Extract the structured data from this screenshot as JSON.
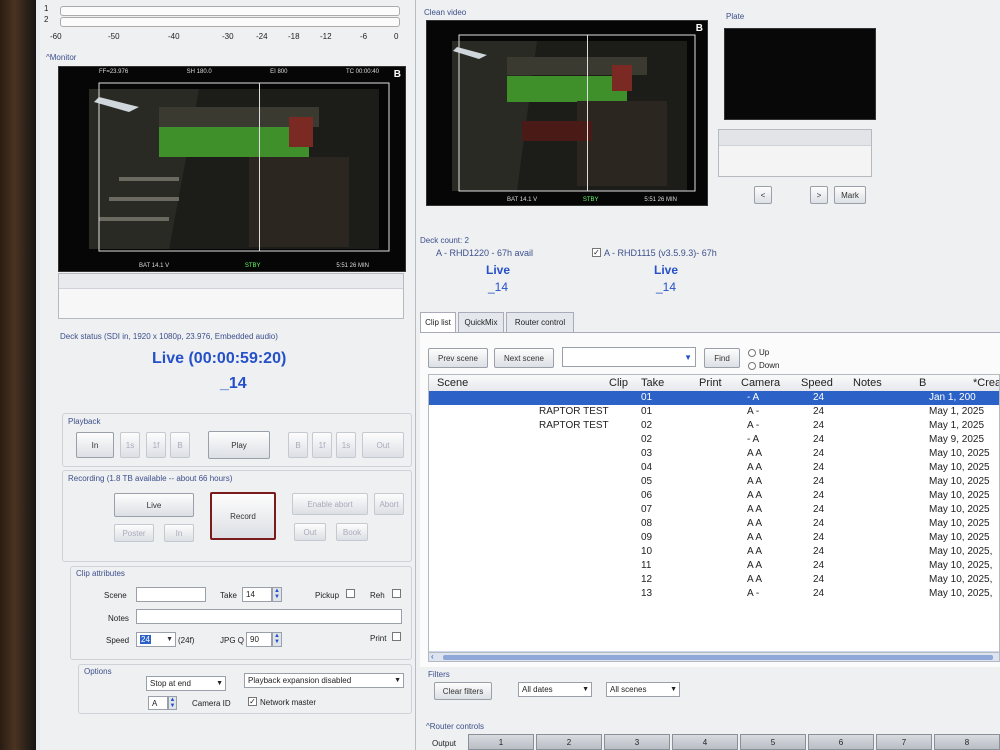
{
  "meters": {
    "channels": [
      "1",
      "2"
    ],
    "scale": [
      "-60",
      "-50",
      "-40",
      "-30",
      "-24",
      "-18",
      "-12",
      "-6",
      "0"
    ]
  },
  "monitor": {
    "title": "^Monitor",
    "overlay_top": [
      "FF=23.976",
      "SH 180.0",
      "EI 800",
      "TC 00:00:40"
    ],
    "overlay_bottom": [
      "BAT 14.1 V",
      "STBY",
      "5:51 26 MIN"
    ],
    "corner_badge": "B"
  },
  "clean_video": {
    "title": "Clean video",
    "overlay_bottom": [
      "BAT 14.1 V",
      "STBY",
      "5:51 26 MIN"
    ],
    "corner_badge": "B"
  },
  "plate": {
    "title": "Plate",
    "prev_label": "<",
    "next_label": ">",
    "mark_label": "Mark"
  },
  "decks": {
    "count_label": "Deck count: 2",
    "deck_a": {
      "name": "A - RHD1220 - 67h avail",
      "status": "Live",
      "clip": "_14"
    },
    "deck_b": {
      "name": "A - RHD1115 (v3.5.9.3)- 67h",
      "status": "Live",
      "clip": "_14",
      "checked": true
    }
  },
  "deck_status": {
    "label": "Deck status (SDI in, 1920 x 1080p, 23.976, Embedded audio)",
    "live": "Live (00:00:59:20)",
    "clip": "_14"
  },
  "playback": {
    "title": "Playback",
    "in": "In",
    "b1": "1s",
    "b2": "1f",
    "b3": "B",
    "play": "Play",
    "a1": "B",
    "a2": "1f",
    "a3": "1s",
    "out": "Out"
  },
  "recording": {
    "title": "Recording (1.8 TB available -- about 66 hours)",
    "live": "Live",
    "record": "Record",
    "enable_abort": "Enable abort",
    "abort": "Abort",
    "poster": "Poster",
    "in": "In",
    "out": "Out",
    "book": "Book"
  },
  "clip_attributes": {
    "title": "Clip attributes",
    "scene_label": "Scene",
    "take_label": "Take",
    "take_value": "14",
    "pickup_label": "Pickup",
    "reh_label": "Reh",
    "notes_label": "Notes",
    "speed_label": "Speed",
    "speed_value": "24",
    "speed_suffix": "(24f)",
    "jpgq_label": "JPG Q",
    "jpgq_value": "90",
    "print_label": "Print"
  },
  "options": {
    "title": "Options",
    "end_mode": "Stop at end",
    "expansion": "Playback expansion disabled",
    "camera_value": "A",
    "camera_label": "Camera ID",
    "network_master": "Network master",
    "network_checked": true
  },
  "tabs": [
    "Clip list",
    "QuickMix",
    "Router control"
  ],
  "search": {
    "prev_scene": "Prev scene",
    "next_scene": "Next scene",
    "find": "Find",
    "up": "Up",
    "down": "Down"
  },
  "table": {
    "headers": [
      "Scene",
      "Clip",
      "Take",
      "Print",
      "Camera",
      "Speed",
      "Notes",
      "B",
      "*Crea"
    ],
    "rows": [
      {
        "scene": "",
        "take": "01",
        "camera": "- A",
        "speed": "24",
        "created": "Jan 1, 200",
        "selected": true
      },
      {
        "scene": "RAPTOR TEST",
        "take": "01",
        "camera": "A -",
        "speed": "24",
        "created": "May 1, 2025"
      },
      {
        "scene": "RAPTOR TEST",
        "take": "02",
        "camera": "A -",
        "speed": "24",
        "created": "May 1, 2025"
      },
      {
        "scene": "",
        "take": "02",
        "camera": "- A",
        "speed": "24",
        "created": "May 9, 2025"
      },
      {
        "scene": "",
        "take": "03",
        "camera": "A A",
        "speed": "24",
        "created": "May 10, 2025"
      },
      {
        "scene": "",
        "take": "04",
        "camera": "A A",
        "speed": "24",
        "created": "May 10, 2025"
      },
      {
        "scene": "",
        "take": "05",
        "camera": "A A",
        "speed": "24",
        "created": "May 10, 2025"
      },
      {
        "scene": "",
        "take": "06",
        "camera": "A A",
        "speed": "24",
        "created": "May 10, 2025"
      },
      {
        "scene": "",
        "take": "07",
        "camera": "A A",
        "speed": "24",
        "created": "May 10, 2025"
      },
      {
        "scene": "",
        "take": "08",
        "camera": "A A",
        "speed": "24",
        "created": "May 10, 2025"
      },
      {
        "scene": "",
        "take": "09",
        "camera": "A A",
        "speed": "24",
        "created": "May 10, 2025"
      },
      {
        "scene": "",
        "take": "10",
        "camera": "A A",
        "speed": "24",
        "created": "May 10, 2025,"
      },
      {
        "scene": "",
        "take": "11",
        "camera": "A A",
        "speed": "24",
        "created": "May 10, 2025,"
      },
      {
        "scene": "",
        "take": "12",
        "camera": "A A",
        "speed": "24",
        "created": "May 10, 2025,"
      },
      {
        "scene": "",
        "take": "13",
        "camera": "A -",
        "speed": "24",
        "created": "May 10, 2025,"
      }
    ]
  },
  "filters": {
    "title": "Filters",
    "clear": "Clear filters",
    "dates": "All dates",
    "scenes": "All scenes"
  },
  "router": {
    "title": "^Router controls",
    "output_label": "Output",
    "outputs": [
      "1",
      "2",
      "3",
      "4",
      "5",
      "6",
      "7",
      "8"
    ]
  },
  "colors": {
    "accent": "#2550c8",
    "selection": "#2c62c8",
    "record_border": "#7a1c1c",
    "label": "#3d4f8a"
  }
}
